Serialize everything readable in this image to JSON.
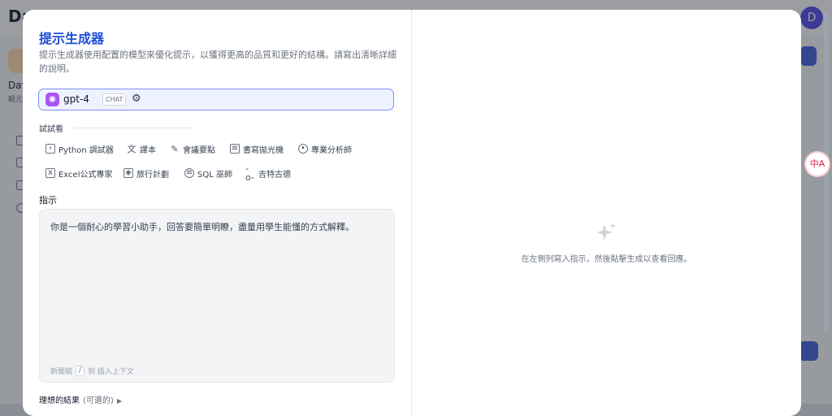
{
  "background": {
    "logo": "Da",
    "avatar_initial": "D",
    "app_name": "Day",
    "app_subtitle": "観元",
    "translate_badge": "中A"
  },
  "modal": {
    "title": "提示生成器",
    "description": "提示生成器使用配置的模型來優化提示，以獲得更高的品質和更好的結構。請寫出清晰詳細的說明。",
    "model": {
      "name": "gpt-4",
      "badge": "CHAT",
      "logo_icon": "openai-icon",
      "settings_icon": "sliders-icon"
    },
    "try_section_label": "試試看",
    "try_items": [
      {
        "label": "Python 調試器",
        "icon": "terminal-icon"
      },
      {
        "label": "譯本",
        "icon": "translate-icon"
      },
      {
        "label": "會議要點",
        "icon": "meeting-icon"
      },
      {
        "label": "書寫拋光機",
        "icon": "document-icon"
      },
      {
        "label": "專業分析師",
        "icon": "user-icon"
      },
      {
        "label": "Excel公式專家",
        "icon": "excel-icon"
      },
      {
        "label": "旅行計劃",
        "icon": "map-icon"
      },
      {
        "label": "SQL 巫師",
        "icon": "database-icon"
      },
      {
        "label": "吉特古德",
        "icon": "git-commit-icon"
      }
    ],
    "instruction_label": "指示",
    "instruction_text": "你是一個耐心的學習小助手，回答要簡單明瞭，盡量用學生能懂的方式解釋。",
    "instruction_hint_prefix": "新聞稿",
    "instruction_hint_key": "/",
    "instruction_hint_suffix": "到 插入上下文",
    "result_label": "理想的結果",
    "result_optional": "(可選的)",
    "empty_state_text": "在左側列寫入指示，然後點擊生成以查看回應。"
  }
}
